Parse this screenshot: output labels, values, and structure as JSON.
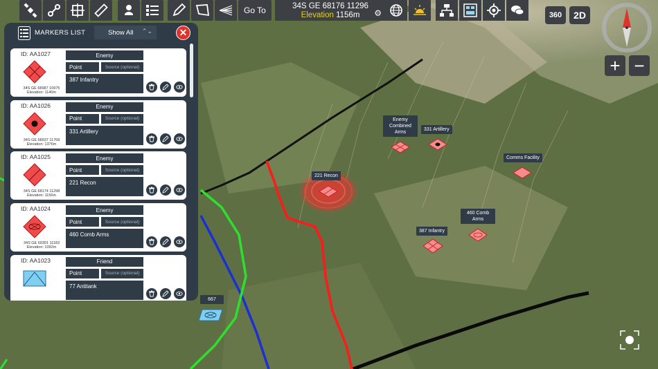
{
  "toolbar": {
    "goto_label": "Go To",
    "coords": "34S GE 68176 11296",
    "elevation_label": "Elevation",
    "elevation_value": "1156m"
  },
  "panel": {
    "title": "MARKERS LIST",
    "filter": "Show All",
    "markers": [
      {
        "id": "ID: AA1027",
        "affiliation": "Enemy",
        "type": "Point",
        "source_placeholder": "Source (optional)",
        "name": "387 Infantry",
        "grid": "34S GE 68987 10975",
        "elev": "Elevation: 1140m",
        "symbol": "hostile-infantry"
      },
      {
        "id": "ID: AA1026",
        "affiliation": "Enemy",
        "type": "Point",
        "source_placeholder": "Source (optional)",
        "name": "331 Artillery",
        "grid": "34S GE 68937 11768",
        "elev": "Elevation: 1376m",
        "symbol": "hostile-artillery"
      },
      {
        "id": "ID: AA1025",
        "affiliation": "Enemy",
        "type": "Point",
        "source_placeholder": "Source (optional)",
        "name": "221 Recon",
        "grid": "34S GE 68174 11298",
        "elev": "Elevation: 1156m",
        "symbol": "hostile-recon"
      },
      {
        "id": "ID: AA1024",
        "affiliation": "Enemy",
        "type": "Point",
        "source_placeholder": "Source (optional)",
        "name": "460 Comb Arms",
        "grid": "34S GE 69301 11183",
        "elev": "Elevation: 1092m",
        "symbol": "hostile-combined-arms"
      },
      {
        "id": "ID: AA1023",
        "affiliation": "Friend",
        "type": "Point",
        "source_placeholder": "Source (optional)",
        "name": "77 Antitank",
        "grid": "",
        "elev": "",
        "symbol": "friendly-antitank"
      }
    ]
  },
  "map_labels": {
    "enemy_combined_arms": "Enemy\nCombined\nArms",
    "artillery": "331 Artillery",
    "comms": "Comms Facility",
    "recon": "221 Recon",
    "comb_arms": "460 Comb\nArms",
    "infantry": "387 Infantry",
    "friend667": "667"
  },
  "controls": {
    "view360": "360",
    "view2d": "2D",
    "zoom_in": "+",
    "zoom_out": "−"
  },
  "colors": {
    "hostile": "#f04a4a",
    "friendly": "#7ecff2",
    "panel": "#2f3b47",
    "close": "#e0312b"
  }
}
